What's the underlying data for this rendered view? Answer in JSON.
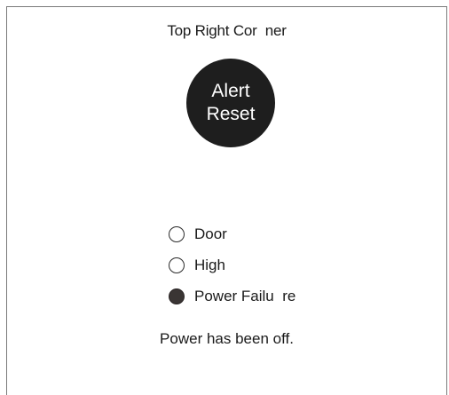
{
  "header": {
    "corner_label": "Top Right Cor  ner"
  },
  "alert_reset_button": {
    "line1": "Alert",
    "line2": "Reset",
    "color": "#1e1e1e"
  },
  "indicators": [
    {
      "label": "Door",
      "active": false
    },
    {
      "label": "High",
      "active": false
    },
    {
      "label": "Power Failu  re",
      "active": true
    }
  ],
  "status_message": "Power has been off.",
  "colors": {
    "active_indicator": "#3a3534",
    "border": "#7a7a7a"
  }
}
